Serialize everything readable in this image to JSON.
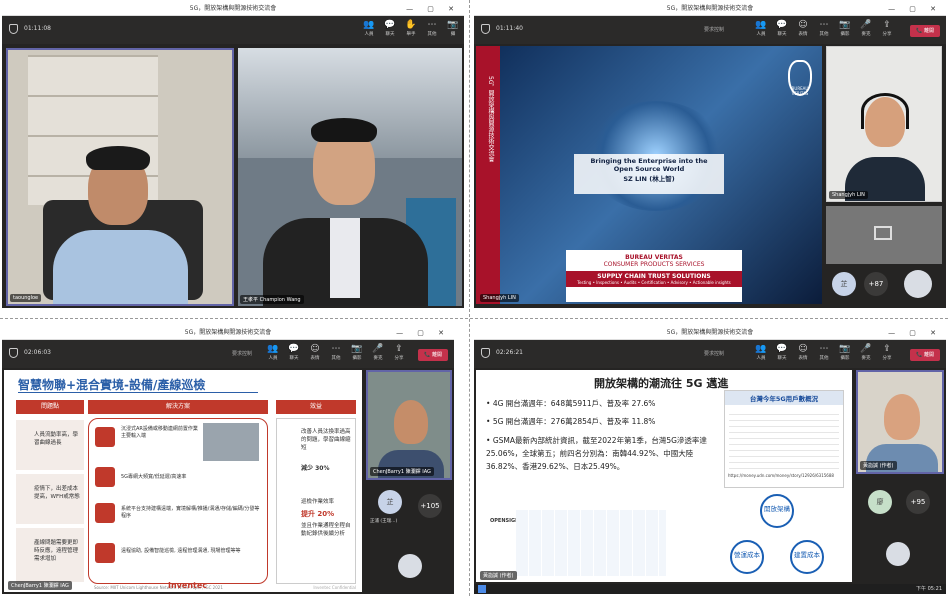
{
  "window_title": "5G，開放架構與開源技術交流會",
  "q1": {
    "timer": "01:11:08",
    "names": [
      "taoungloe",
      "王孝平 Champion Wang"
    ]
  },
  "q2": {
    "timer": "01:11:40",
    "slide": {
      "vertical": "5G，開放架構與開源技術交流會",
      "title1": "Bringing the Enterprise into the",
      "title2": "Open Source World",
      "presenter": "SZ LIN (林上智)",
      "bv": "BUREAU VERITAS",
      "cps": "CONSUMER PRODUCTS SERVICES",
      "sct": "SUPPLY CHAIN TRUST SOLUTIONS",
      "tag": "Testing • Inspections • Audits • Certification • Advisory • Actionable insights",
      "logo": "BUREAU VERITAS"
    },
    "name": "Shangjyh LIN",
    "p_name": "Shangjyh LIN",
    "avatar": "芷",
    "count": "+87",
    "share_label": "要求控制"
  },
  "q3": {
    "timer": "02:06:03",
    "share_label": "要求控制",
    "slide": {
      "title": "智慧物聯+混合實境-設備/產線巡檢",
      "h1": "問題點",
      "h2": "解決方案",
      "h3": "效益",
      "problems": [
        "人員流動率高，學習曲線過長",
        "疫情下，出差成本提高，WFH或常態",
        "產線問題需要更即時反應，遠程管理需求增加"
      ],
      "solutions": [
        "沉浸式AR設備或移動連網前置作業主要輸入端",
        "5G專網大頻寬/低延遲/高速率",
        "系統平台支持建構遠端，實境解構/推播/溝通/存儲/編碼/分發等程序",
        "遠程協助, 設備智能巡檢, 遠程管理溝通, 現場管理等等"
      ],
      "benefits": [
        "改善人員汰換率過高的問題，學習曲線縮短",
        "減少 30%",
        "巡檢作業效率",
        "提升 20%",
        "並且作業通程全程自動紀錄供後續分析"
      ],
      "footer": "Source: MIIT Unicom Lighthouse Network White Paper, IGC 2021",
      "brand": "Inventec",
      "conf": "Inventec Confidential"
    },
    "names": [
      "ChenJBarry1 陳瀾鐸 IAG",
      "正浦 (王瑞...)"
    ],
    "count": "+105"
  },
  "q4": {
    "timer": "02:26:21",
    "share_label": "要求控制",
    "slide": {
      "title": "開放架構的潮流往 5G 邁進",
      "bullets": [
        "4G 開台滿週年：648萬5911戶、普及率 27.6%",
        "5G 開台滿週年：276萬2854戶、普及率 11.8%",
        "GSMA最新內部統計資訊，截至2022年第1季，台灣5G滲透率達25.06%，全球第五；前四名分別為：南韓44.92%、中國大陸36.82%、香港29.62%、日本25.49%。"
      ],
      "box_title": "台灣今年5G用戶數概況",
      "link": "https://money.udn.com/money/story/12926/6315688",
      "opensignal": "OPENSIGNAL",
      "cycle": [
        "開放架構",
        "營運成本",
        "建置成本"
      ]
    },
    "name": "黃詣誠 (作者)",
    "avatar": "廖",
    "count": "+95",
    "taskbar_time": "下午 05:21"
  }
}
